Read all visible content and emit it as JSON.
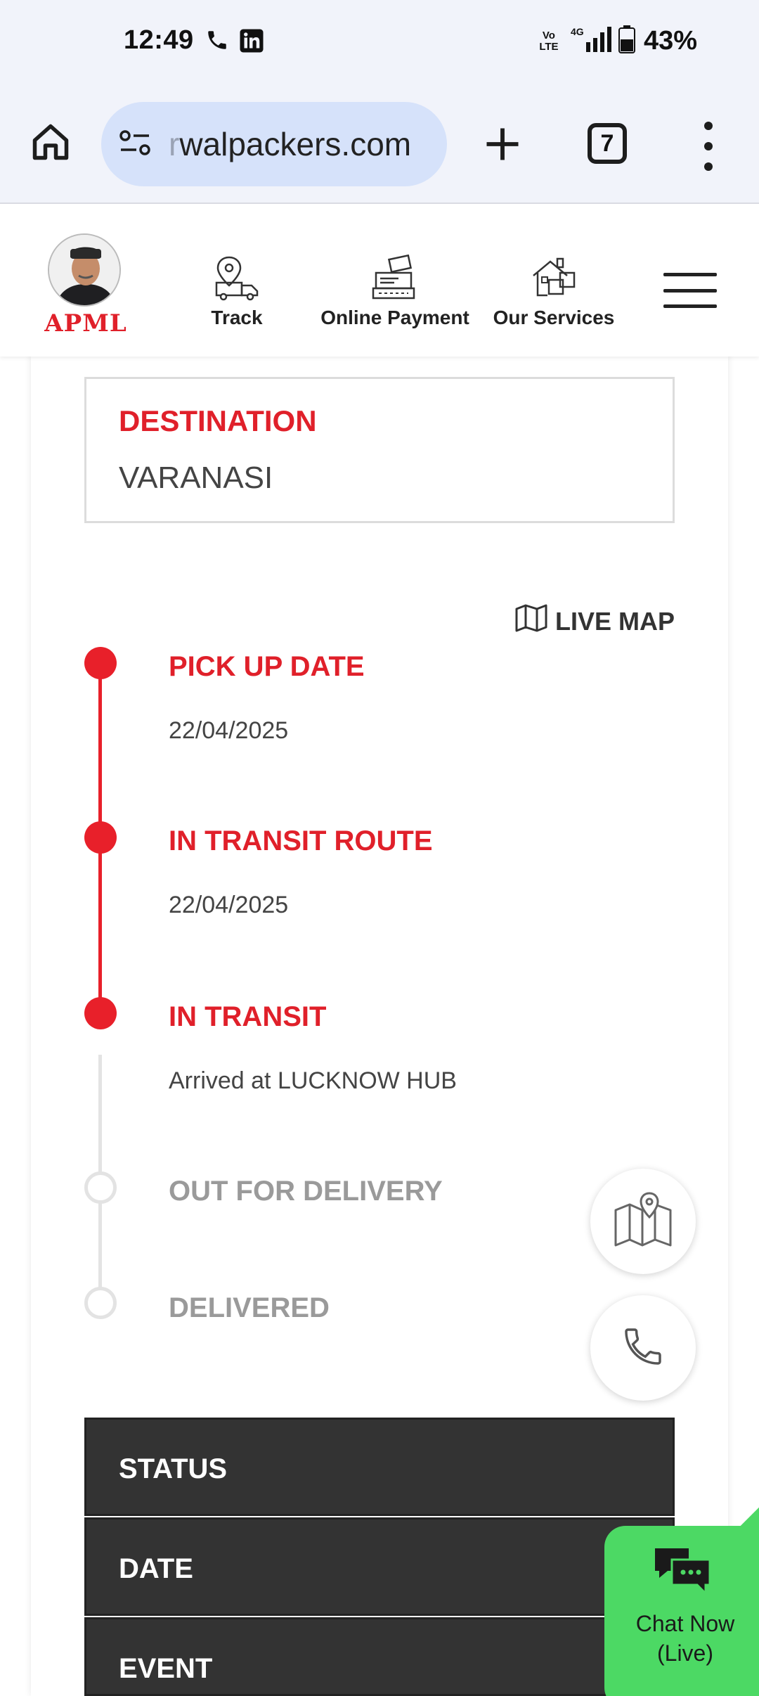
{
  "status_bar": {
    "time": "12:49",
    "network_label": "Vo LTE",
    "network_type": "4G",
    "battery": "43%"
  },
  "browser": {
    "url_fade": "r",
    "url": "walpackers.com",
    "tab_count": "7"
  },
  "site_header": {
    "logo_text": "APML",
    "nav": [
      {
        "label": "Track",
        "icon": "truck-location-icon"
      },
      {
        "label": "Online Payment",
        "icon": "payment-terminal-icon"
      },
      {
        "label": "Our Services",
        "icon": "services-house-icon"
      }
    ]
  },
  "destination": {
    "label": "DESTINATION",
    "value": "VARANASI"
  },
  "live_map": {
    "label": "LIVE MAP"
  },
  "timeline": [
    {
      "title": "PICK UP DATE",
      "detail": "22/04/2025",
      "status": "done"
    },
    {
      "title": "IN TRANSIT ROUTE",
      "detail": "22/04/2025",
      "status": "done"
    },
    {
      "title": "IN TRANSIT",
      "detail": "Arrived at LUCKNOW HUB",
      "status": "done"
    },
    {
      "title": "OUT FOR DELIVERY",
      "detail": "",
      "status": "pending"
    },
    {
      "title": "DELIVERED",
      "detail": "",
      "status": "pending"
    }
  ],
  "table": {
    "rows": [
      "STATUS",
      "DATE",
      "EVENT"
    ]
  },
  "chat": {
    "line1": "Chat Now",
    "line2": "(Live)"
  },
  "colors": {
    "accent_red": "#e8202a",
    "chat_green": "#4cd964",
    "table_dark": "#333333"
  }
}
